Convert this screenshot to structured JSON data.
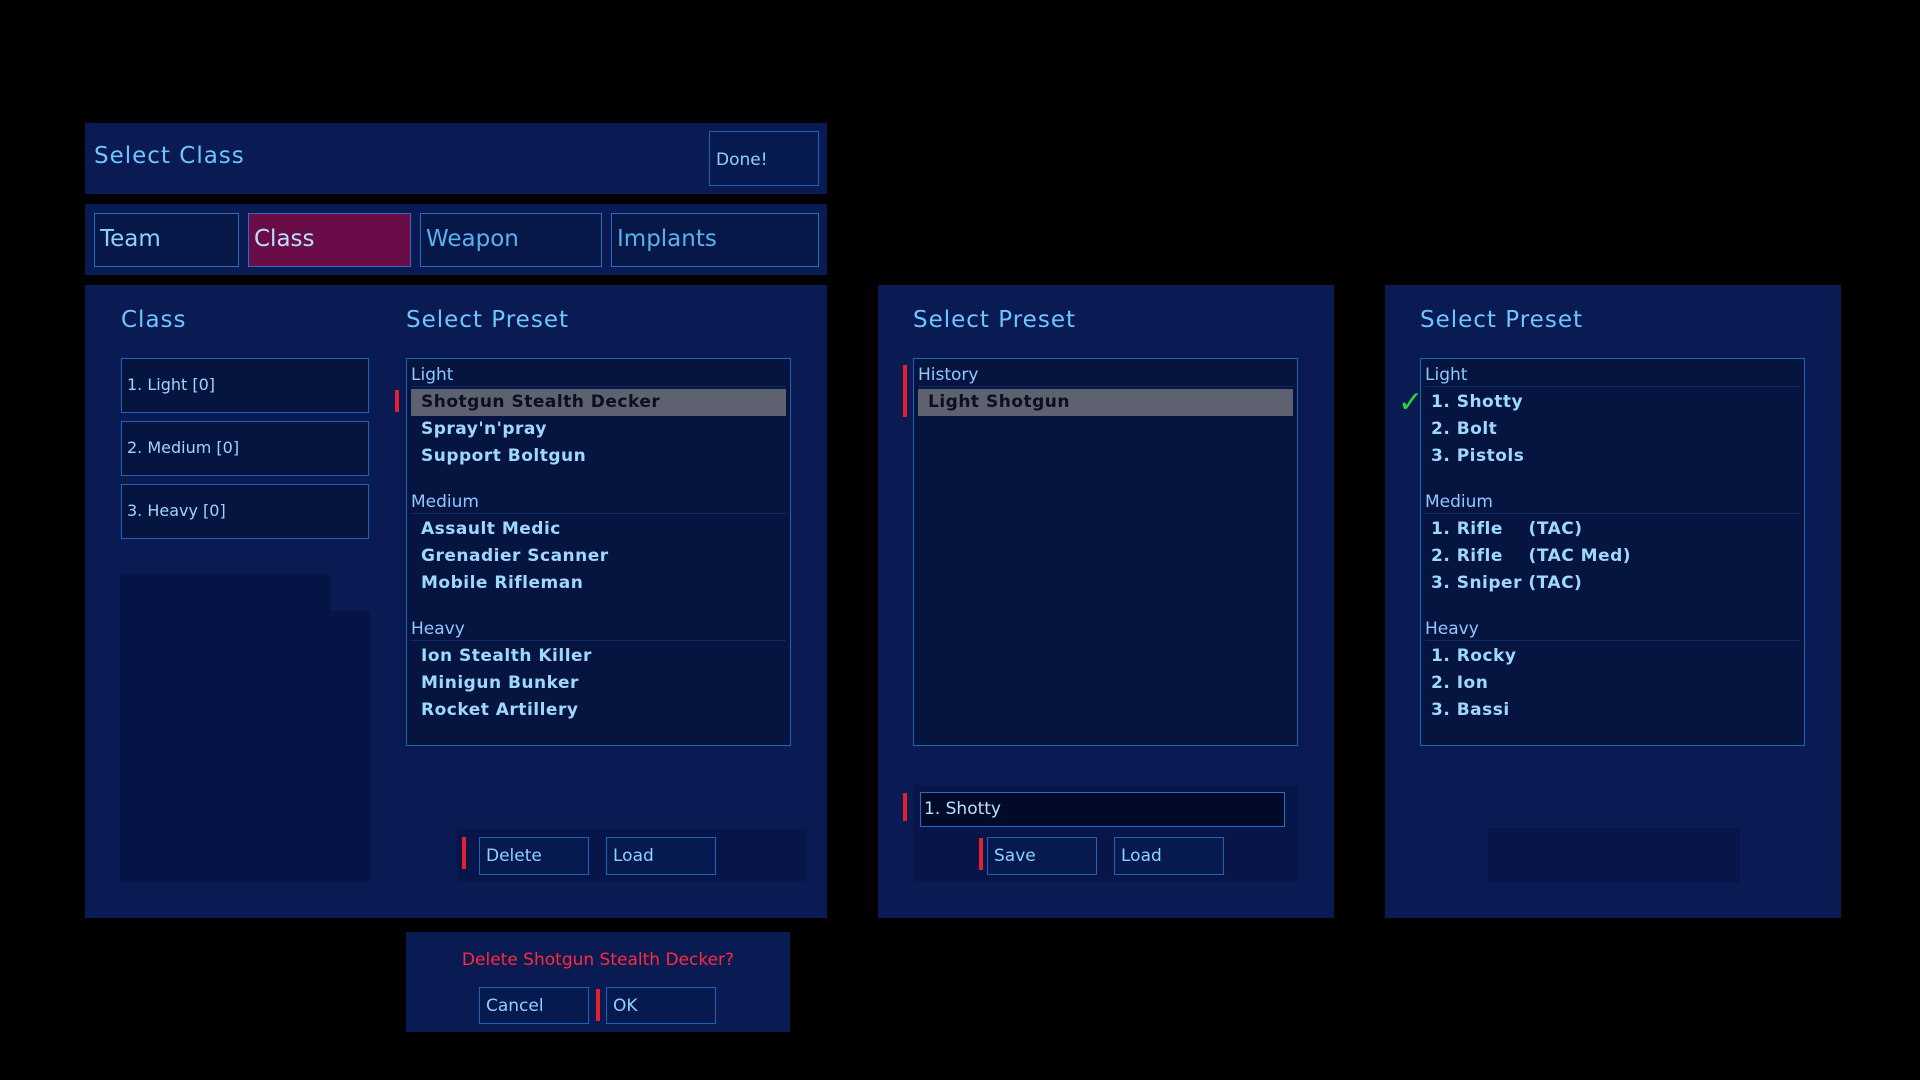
{
  "header": {
    "title": "Select Class",
    "done_label": "Done!"
  },
  "tabs": [
    {
      "label": "Team"
    },
    {
      "label": "Class"
    },
    {
      "label": "Weapon"
    },
    {
      "label": "Implants"
    }
  ],
  "class_panel": {
    "class_heading": "Class",
    "classes": [
      {
        "label": "1. Light [0]"
      },
      {
        "label": "2. Medium [0]"
      },
      {
        "label": "3. Heavy [0]"
      }
    ],
    "preset_heading": "Select Preset",
    "groups": [
      {
        "name": "Light",
        "items": [
          "Shotgun Stealth Decker",
          "Spray'n'pray",
          "Support Boltgun"
        ]
      },
      {
        "name": "Medium",
        "items": [
          "Assault Medic",
          "Grenadier Scanner",
          "Mobile Rifleman"
        ]
      },
      {
        "name": "Heavy",
        "items": [
          "Ion Stealth Killer",
          "Minigun Bunker",
          "Rocket Artillery"
        ]
      }
    ],
    "delete_label": "Delete",
    "load_label": "Load"
  },
  "confirm_dialog": {
    "message": "Delete Shotgun Stealth Decker?",
    "cancel_label": "Cancel",
    "ok_label": "OK"
  },
  "history_panel": {
    "heading": "Select Preset",
    "group": "History",
    "items": [
      "Light Shotgun"
    ],
    "name_input_value": "1. Shotty",
    "save_label": "Save",
    "load_label": "Load"
  },
  "quick_panel": {
    "heading": "Select Preset",
    "groups": [
      {
        "name": "Light",
        "items": [
          "1. Shotty",
          "2. Bolt",
          "3. Pistols"
        ]
      },
      {
        "name": "Medium",
        "items": [
          "1. Rifle    (TAC)",
          "2. Rifle    (TAC Med)",
          "3. Sniper (TAC)"
        ]
      },
      {
        "name": "Heavy",
        "items": [
          "1. Rocky",
          "2. Ion",
          "3. Bassi"
        ]
      }
    ],
    "check_icon": "✓"
  },
  "colors": {
    "panel": "#0a1a52",
    "accent_red": "#e0212e",
    "active_tab": "#6a0c48",
    "check_green": "#2fcf3f"
  }
}
